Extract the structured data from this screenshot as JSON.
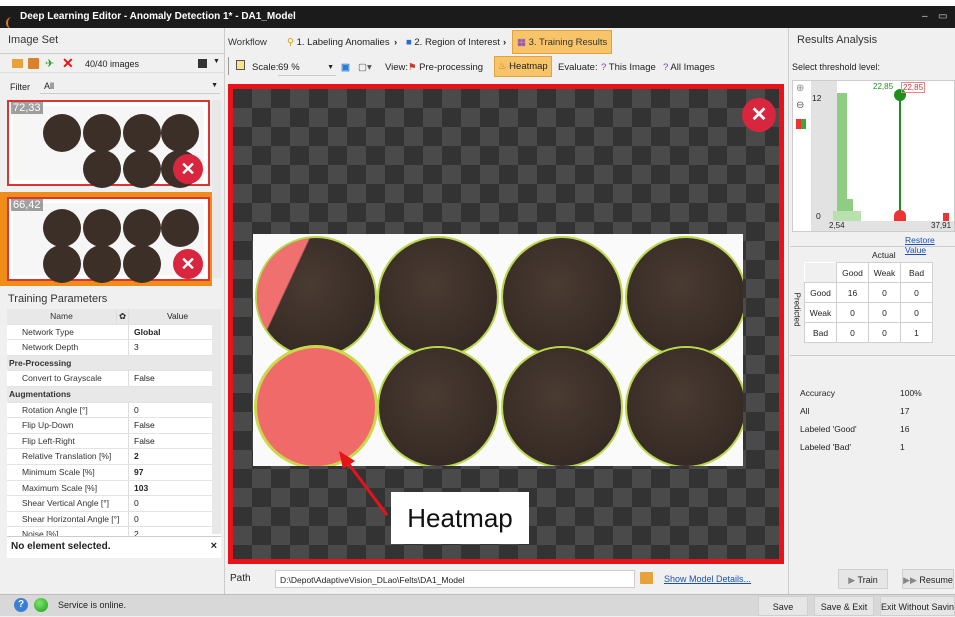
{
  "window": {
    "title": "Deep Learning Editor - Anomaly Detection 1* - DA1_Model"
  },
  "left": {
    "header": "Image Set",
    "count": "40/40 images",
    "filter_label": "Filter",
    "filter_value": "All",
    "thumbs": [
      {
        "score": "72,33"
      },
      {
        "score": "66,42"
      }
    ],
    "params_header": "Training Parameters",
    "col_name": "Name",
    "col_value": "Value",
    "rows": [
      {
        "name": "Network Type",
        "value": "Global",
        "bold": true
      },
      {
        "name": "Network Depth",
        "value": "3"
      },
      {
        "category": "Pre-Processing"
      },
      {
        "name": "Convert to Grayscale",
        "value": "False"
      },
      {
        "category": "Augmentations"
      },
      {
        "name": "Rotation Angle [°]",
        "value": "0"
      },
      {
        "name": "Flip Up-Down",
        "value": "False"
      },
      {
        "name": "Flip Left-Right",
        "value": "False"
      },
      {
        "name": "Relative Translation [%]",
        "value": "2",
        "bold": true
      },
      {
        "name": "Minimum Scale [%]",
        "value": "97",
        "bold": true
      },
      {
        "name": "Maximum Scale [%]",
        "value": "103",
        "bold": true
      },
      {
        "name": "Shear Vertical Angle [°]",
        "value": "0"
      },
      {
        "name": "Shear Horizontal Angle [°]",
        "value": "0"
      },
      {
        "name": "Noise [%]",
        "value": "2"
      }
    ],
    "selection": "No element selected.",
    "close": "×"
  },
  "center": {
    "workflow": "Workflow",
    "steps": [
      "1. Labeling Anomalies",
      "2. Region of Interest",
      "3. Training Results"
    ],
    "scale_label": "Scale:",
    "scale_value": "69 %",
    "view_label": "View:",
    "preprocessing": "Pre-processing",
    "heatmap": "Heatmap",
    "evaluate_label": "Evaluate:",
    "this_image": "This Image",
    "all_images": "All Images",
    "annotation": "Heatmap",
    "path_label": "Path",
    "path_value": "D:\\Depot\\AdaptiveVision_DLao\\Felts\\DA1_Model",
    "show_model": "Show Model Details..."
  },
  "right": {
    "header": "Results Analysis",
    "threshold_label": "Select threshold level:",
    "threshold_values": [
      "22,85",
      "22,85"
    ],
    "hist_ymax": "12",
    "hist_ymin": "0",
    "hist_xmin": "2,54",
    "hist_xmax": "37,91",
    "restore": "Restore Value",
    "actual": "Actual",
    "predicted": "Predicted",
    "cols": [
      "Good",
      "Weak",
      "Bad"
    ],
    "matrix": [
      {
        "label": "Good",
        "vals": [
          "16",
          "0",
          "0"
        ]
      },
      {
        "label": "Weak",
        "vals": [
          "0",
          "0",
          "0"
        ]
      },
      {
        "label": "Bad",
        "vals": [
          "0",
          "0",
          "1"
        ]
      }
    ],
    "stats": [
      {
        "label": "Accuracy",
        "value": "100%"
      },
      {
        "label": "All",
        "value": "17"
      },
      {
        "label": "Labeled 'Good'",
        "value": "16"
      },
      {
        "label": "Labeled 'Bad'",
        "value": "1"
      }
    ],
    "train": "Train",
    "resume": "Resume"
  },
  "status": {
    "text": "Service is online.",
    "save": "Save",
    "save_exit": "Save & Exit",
    "exit_nosave": "Exit Without Saving"
  }
}
